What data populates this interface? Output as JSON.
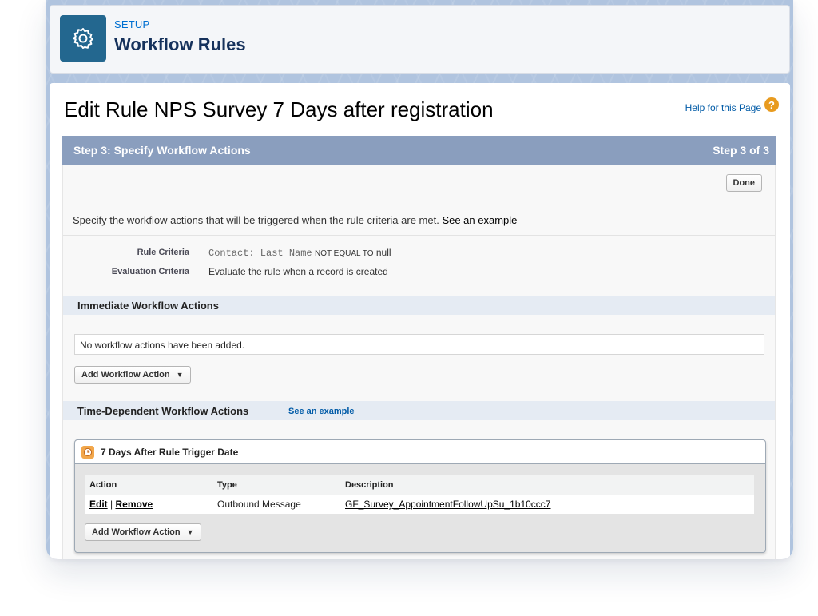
{
  "header": {
    "kicker": "SETUP",
    "title": "Workflow Rules",
    "icon": "gear-icon"
  },
  "page": {
    "title": "Edit Rule NPS Survey 7 Days after registration",
    "help_link": "Help for this Page",
    "help_icon": "question-icon",
    "help_glyph": "?"
  },
  "step_bar": {
    "title": "Step 3: Specify Workflow Actions",
    "step_indicator": "Step 3 of 3"
  },
  "done_label": "Done",
  "intro": {
    "text": "Specify the workflow actions that will be triggered when the rule criteria are met. ",
    "link": "See an example"
  },
  "criteria": {
    "rule_label": "Rule Criteria",
    "rule_field": "Contact: Last Name",
    "rule_operator": "NOT EQUAL TO",
    "rule_value": "null",
    "eval_label": "Evaluation Criteria",
    "eval_value": "Evaluate the rule when a record is created"
  },
  "immediate": {
    "title": "Immediate Workflow Actions",
    "empty_text": "No workflow actions have been added.",
    "add_button": "Add Workflow Action"
  },
  "time_dependent": {
    "title": "Time-Dependent Workflow Actions",
    "link": "See an example",
    "trigger": {
      "title": "7 Days After Rule Trigger Date",
      "icon": "clock-icon",
      "columns": [
        "Action",
        "Type",
        "Description"
      ],
      "rows": [
        {
          "edit": "Edit",
          "separator": "|",
          "remove": "Remove",
          "type": "Outbound Message",
          "description": "GF_Survey_AppointmentFollowUpSu_1b10ccc7"
        }
      ],
      "add_button": "Add Workflow Action"
    }
  },
  "caret_glyph": "▼",
  "colors": {
    "header_icon_bg": "#23678f",
    "step_bar": "#8a9ebe",
    "section_bar": "#e5ebf3",
    "link": "#015ba7",
    "help_icon": "#e89b1f"
  }
}
